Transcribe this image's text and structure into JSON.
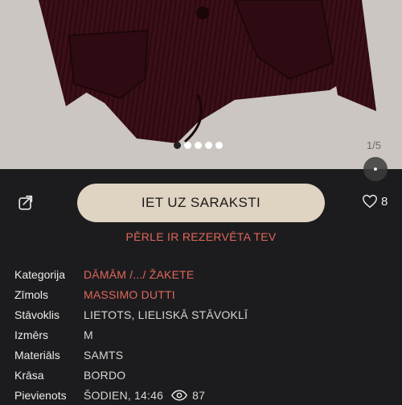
{
  "gallery": {
    "counter": "1/5",
    "total": 5,
    "active_index": 0
  },
  "actions": {
    "primary_label": "IET UZ SARAKSTI",
    "like_count": "8",
    "reserved_note": "PĒRLE IR REZERVĒTA TEV"
  },
  "details": {
    "category": {
      "label": "Kategorija",
      "value": "DĀMĀM /.../ ŽAKETE"
    },
    "brand": {
      "label": "Zīmols",
      "value": "MASSIMO DUTTI"
    },
    "condition": {
      "label": "Stāvoklis",
      "value": "LIETOTS, LIELISKĀ STĀVOKLĪ"
    },
    "size": {
      "label": "Izmērs",
      "value": "M"
    },
    "material": {
      "label": "Materiāls",
      "value": "SAMTS"
    },
    "color": {
      "label": "Krāsa",
      "value": "BORDO"
    },
    "added": {
      "label": "Pievienots",
      "value": "ŠODIEN, 14:46",
      "views": "87"
    }
  },
  "colors": {
    "background": "#1c1c1e",
    "accent": "#e0675a",
    "primary_button": "#dfd3c1",
    "garment": "#3a0f16"
  },
  "icons": {
    "share": "share-icon",
    "like": "heart-icon",
    "views": "eye-icon"
  }
}
